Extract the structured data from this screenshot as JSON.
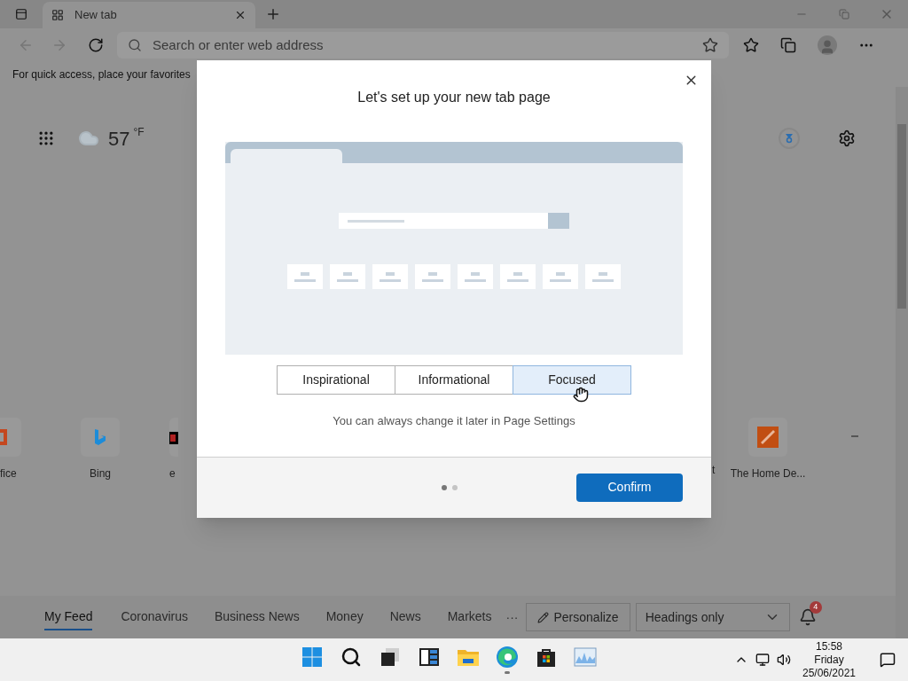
{
  "browser": {
    "tabs": [
      {
        "title": "New tab",
        "selected": true
      }
    ],
    "address_placeholder": "Search or enter web address",
    "favorites_hint": "For quick access, place your favorites"
  },
  "new_tab_page": {
    "weather": {
      "temperature": "57",
      "unit": "°F"
    },
    "tiles": [
      {
        "label": "fice",
        "kind": "office"
      },
      {
        "label": "Bing",
        "kind": "bing"
      },
      {
        "label": "e",
        "kind": "ebay"
      },
      {
        "label": "t",
        "kind": "hidden"
      },
      {
        "label": "The Home De...",
        "kind": "homedepot"
      }
    ],
    "feed_tabs": [
      {
        "label": "My Feed",
        "selected": true
      },
      {
        "label": "Coronavirus",
        "selected": false
      },
      {
        "label": "Business News",
        "selected": false
      },
      {
        "label": "Money",
        "selected": false
      },
      {
        "label": "News",
        "selected": false
      },
      {
        "label": "Markets",
        "selected": false
      }
    ],
    "more": "···",
    "personalize": "Personalize",
    "layout_select": "Headings only",
    "notification_count": "4"
  },
  "dialog": {
    "title": "Let's set up your new tab page",
    "options": [
      {
        "label": "Inspirational",
        "selected": false
      },
      {
        "label": "Informational",
        "selected": false
      },
      {
        "label": "Focused",
        "selected": true
      }
    ],
    "hint": "You can always change it later in Page Settings",
    "pager": [
      {
        "selected": true
      },
      {
        "selected": false
      }
    ],
    "confirm": "Confirm"
  },
  "taskbar": {
    "apps": [
      {
        "kind": "start",
        "running": false
      },
      {
        "kind": "search",
        "running": false
      },
      {
        "kind": "taskview",
        "running": false
      },
      {
        "kind": "widgets",
        "running": false
      },
      {
        "kind": "explorer",
        "running": false
      },
      {
        "kind": "edge",
        "running": true
      },
      {
        "kind": "store",
        "running": false
      },
      {
        "kind": "monitor",
        "running": false
      }
    ],
    "time": "15:58",
    "day": "Friday",
    "date": "25/06/2021"
  }
}
